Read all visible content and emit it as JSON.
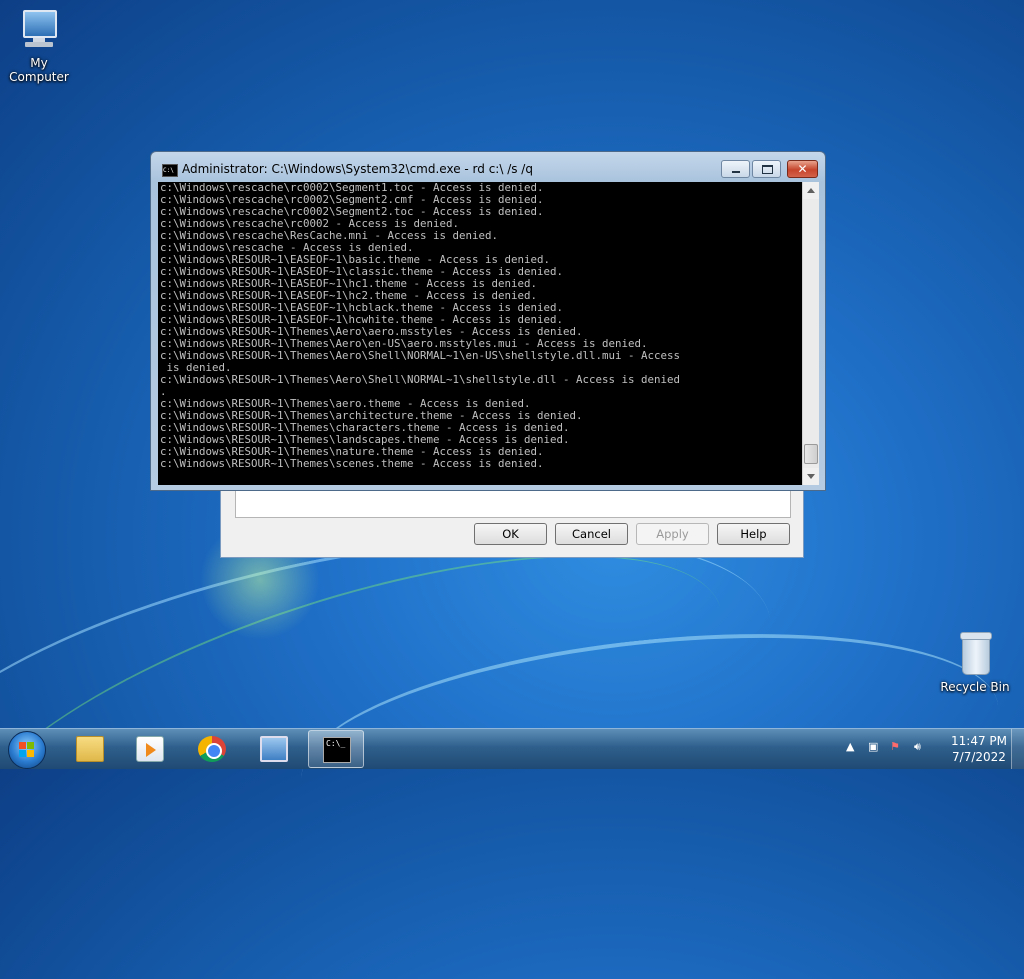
{
  "desktop": {
    "icons": [
      {
        "label": "My Computer",
        "icon": "computer-icon"
      },
      {
        "label": "Recycle Bin",
        "icon": "recycle-bin-icon"
      }
    ]
  },
  "dialog": {
    "buttons": {
      "ok": "OK",
      "cancel": "Cancel",
      "apply": "Apply",
      "help": "Help"
    }
  },
  "cmd_window": {
    "title": "Administrator: C:\\Windows\\System32\\cmd.exe - rd  c:\\ /s /q",
    "icon": "cmd-icon",
    "lines": [
      "c:\\Windows\\rescache\\rc0002\\Segment1.toc - Access is denied.",
      "c:\\Windows\\rescache\\rc0002\\Segment2.cmf - Access is denied.",
      "c:\\Windows\\rescache\\rc0002\\Segment2.toc - Access is denied.",
      "c:\\Windows\\rescache\\rc0002 - Access is denied.",
      "c:\\Windows\\rescache\\ResCache.mni - Access is denied.",
      "c:\\Windows\\rescache - Access is denied.",
      "c:\\Windows\\RESOUR~1\\EASEOF~1\\basic.theme - Access is denied.",
      "c:\\Windows\\RESOUR~1\\EASEOF~1\\classic.theme - Access is denied.",
      "c:\\Windows\\RESOUR~1\\EASEOF~1\\hc1.theme - Access is denied.",
      "c:\\Windows\\RESOUR~1\\EASEOF~1\\hc2.theme - Access is denied.",
      "c:\\Windows\\RESOUR~1\\EASEOF~1\\hcblack.theme - Access is denied.",
      "c:\\Windows\\RESOUR~1\\EASEOF~1\\hcwhite.theme - Access is denied.",
      "c:\\Windows\\RESOUR~1\\Themes\\Aero\\aero.msstyles - Access is denied.",
      "c:\\Windows\\RESOUR~1\\Themes\\Aero\\en-US\\aero.msstyles.mui - Access is denied.",
      "c:\\Windows\\RESOUR~1\\Themes\\Aero\\Shell\\NORMAL~1\\en-US\\shellstyle.dll.mui - Access",
      " is denied.",
      "c:\\Windows\\RESOUR~1\\Themes\\Aero\\Shell\\NORMAL~1\\shellstyle.dll - Access is denied",
      ".",
      "c:\\Windows\\RESOUR~1\\Themes\\aero.theme - Access is denied.",
      "c:\\Windows\\RESOUR~1\\Themes\\architecture.theme - Access is denied.",
      "c:\\Windows\\RESOUR~1\\Themes\\characters.theme - Access is denied.",
      "c:\\Windows\\RESOUR~1\\Themes\\landscapes.theme - Access is denied.",
      "c:\\Windows\\RESOUR~1\\Themes\\nature.theme - Access is denied.",
      "c:\\Windows\\RESOUR~1\\Themes\\scenes.theme - Access is denied."
    ]
  },
  "taskbar": {
    "items": [
      {
        "icon": "folder-icon"
      },
      {
        "icon": "media-player-icon"
      },
      {
        "icon": "chrome-icon"
      },
      {
        "icon": "remote-desktop-icon"
      },
      {
        "icon": "cmd-icon",
        "active": true,
        "label": "C:\\_"
      }
    ],
    "clock": {
      "time": "11:47 PM",
      "date": "7/7/2022"
    }
  },
  "colors": {
    "console_bg": "#000000",
    "console_fg": "#c0c0c0",
    "desktop_bg": "#1f6fc7",
    "taskbar_bg": "#2f5f8c"
  }
}
